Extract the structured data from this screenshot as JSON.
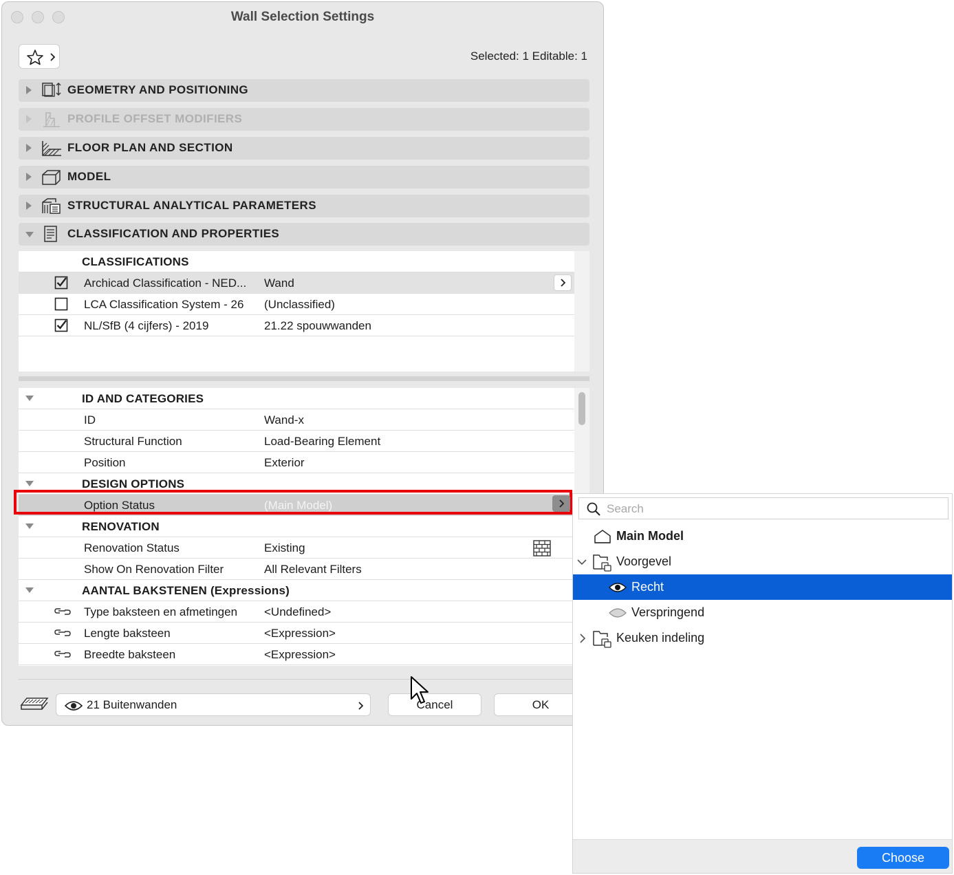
{
  "window": {
    "title": "Wall Selection Settings"
  },
  "selection_info": "Selected: 1 Editable: 1",
  "sections": [
    {
      "label": "GEOMETRY AND POSITIONING",
      "icon": "geometry-icon",
      "enabled": true
    },
    {
      "label": "PROFILE OFFSET MODIFIERS",
      "icon": "profile-offset-icon",
      "enabled": false
    },
    {
      "label": "FLOOR PLAN AND SECTION",
      "icon": "floor-plan-icon",
      "enabled": true
    },
    {
      "label": "MODEL",
      "icon": "model-box-icon",
      "enabled": true
    },
    {
      "label": "STRUCTURAL ANALYTICAL PARAMETERS",
      "icon": "structural-icon",
      "enabled": true
    },
    {
      "label": "CLASSIFICATION AND PROPERTIES",
      "icon": "document-icon",
      "enabled": true,
      "expanded": true
    }
  ],
  "classifications": {
    "header": "CLASSIFICATIONS",
    "rows": [
      {
        "checked": true,
        "name": "Archicad Classification - NED...",
        "value": "Wand"
      },
      {
        "checked": false,
        "name": "LCA Classification System - 26",
        "value": "(Unclassified)"
      },
      {
        "checked": true,
        "name": "NL/SfB (4 cijfers) - 2019",
        "value": "21.22 spouwwanden"
      }
    ]
  },
  "properties": {
    "id_group": "ID AND CATEGORIES",
    "id_label": "ID",
    "id_value": "Wand-x",
    "structural_label": "Structural Function",
    "structural_value": "Load-Bearing Element",
    "position_label": "Position",
    "position_value": "Exterior",
    "design_group": "DESIGN OPTIONS",
    "option_label": "Option Status",
    "option_value": "(Main Model)",
    "renovation_group": "RENOVATION",
    "renovation_status_label": "Renovation Status",
    "renovation_status_value": "Existing",
    "renovation_filter_label": "Show On Renovation Filter",
    "renovation_filter_value": "All Relevant Filters",
    "bricks_group": "AANTAL BAKSTENEN (Expressions)",
    "brick_type_label": "Type baksteen en afmetingen",
    "brick_type_value": "<Undefined>",
    "brick_length_label": "Lengte baksteen",
    "brick_length_value": "<Expression>",
    "brick_width_label": "Breedte baksteen",
    "brick_width_value": "<Expression>"
  },
  "footer": {
    "layer": "21 Buitenwanden",
    "cancel": "Cancel",
    "ok": "OK"
  },
  "popup": {
    "search_placeholder": "Search",
    "main_model": "Main Model",
    "voorgevel": "Voorgevel",
    "recht": "Recht",
    "verspringend": "Verspringend",
    "keuken": "Keuken indeling",
    "choose": "Choose"
  },
  "colors": {
    "highlight_red": "#e8000b",
    "selection_blue": "#0b5fd6",
    "button_blue": "#1a7cf5"
  }
}
